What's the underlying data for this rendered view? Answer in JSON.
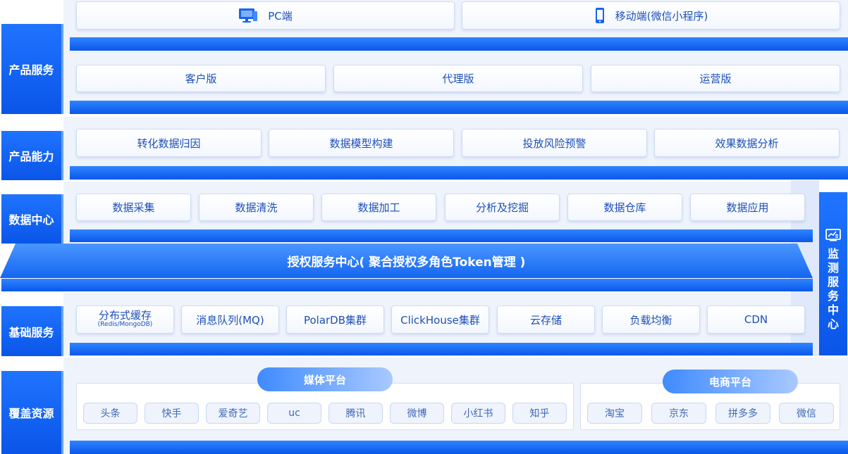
{
  "layers": {
    "product_service": "产品服务",
    "product_capability": "产品能力",
    "data_center": "数据中心",
    "basic_service": "基础服务",
    "coverage": "覆盖资源"
  },
  "product_service": {
    "pc": "PC端",
    "mobile": "移动端(微信小程序)",
    "editions": [
      "客户版",
      "代理版",
      "运营版"
    ]
  },
  "product_capability": {
    "items": [
      "转化数据归因",
      "数据模型构建",
      "投放风险预警",
      "效果数据分析"
    ]
  },
  "data_center": {
    "items": [
      "数据采集",
      "数据清洗",
      "数据加工",
      "分析及挖掘",
      "数据仓库",
      "数据应用"
    ]
  },
  "auth_center": "授权服务中心( 聚合授权多角色Token管理 )",
  "basic_service": {
    "cache_label": "分布式缓存",
    "cache_sub": "(Redis/MongoDB)",
    "items": [
      "消息队列(MQ)",
      "PolarDB集群",
      "ClickHouse集群",
      "云存储",
      "负载均衡",
      "CDN"
    ]
  },
  "monitor": {
    "chars": [
      "监",
      "测",
      "服",
      "务",
      "中",
      "心"
    ],
    "icon": "monitor-chart-icon"
  },
  "coverage": {
    "media_title": "媒体平台",
    "media_items": [
      "头条",
      "快手",
      "爱奇艺",
      "uc",
      "腾讯",
      "微博",
      "小红书",
      "知乎"
    ],
    "ecom_title": "电商平台",
    "ecom_items": [
      "淘宝",
      "京东",
      "拼多多",
      "微信"
    ]
  },
  "colors": {
    "brand_blue": "#0a55e8",
    "card_text": "#1d4fb8",
    "shade": "#eef3fc"
  }
}
